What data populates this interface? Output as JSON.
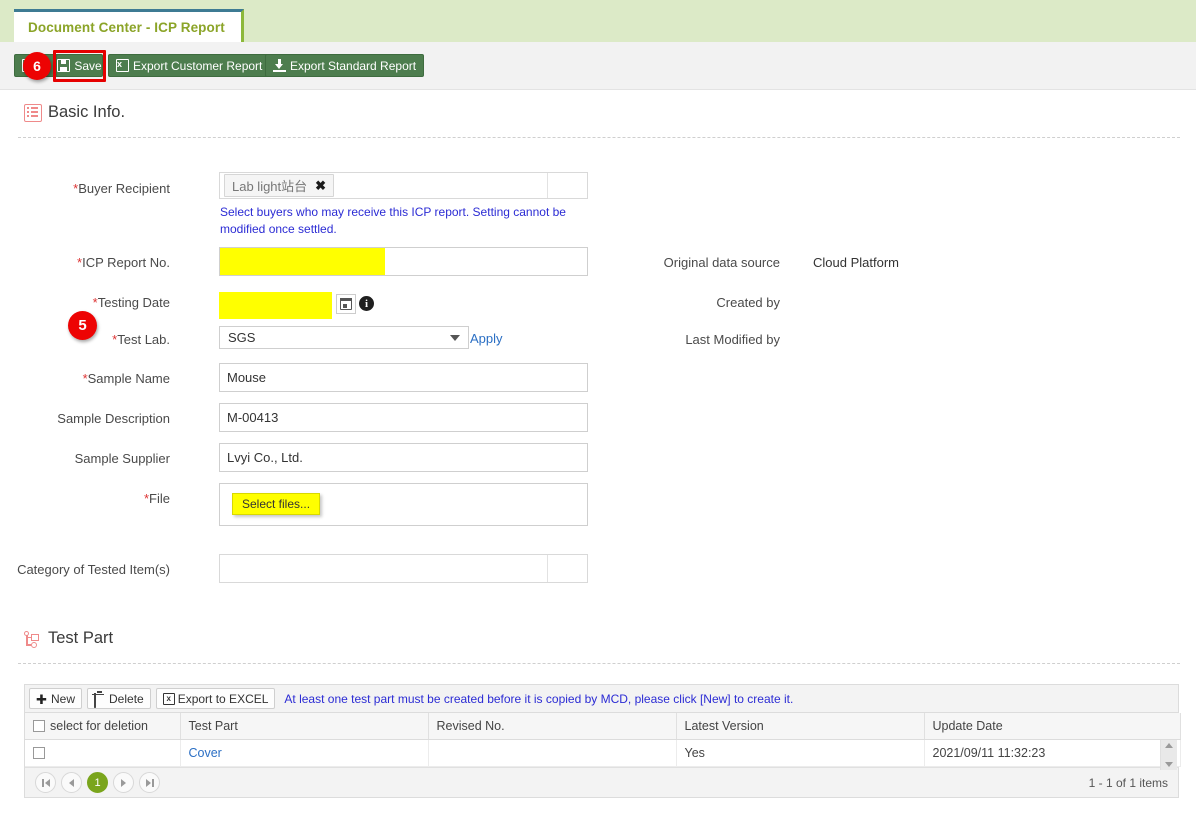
{
  "tab": {
    "label": "Document Center - ICP Report"
  },
  "toolbar": {
    "back_label": "",
    "save_label": "Save",
    "export_customer_label": "Export Customer Report",
    "export_standard_label": "Export Standard Report",
    "icons": {
      "back": "back-icon",
      "save": "floppy-save-icon",
      "excel": "excel-icon",
      "download": "download-icon"
    }
  },
  "badges": {
    "step6": "6",
    "step5": "5"
  },
  "sections": {
    "basic_info": {
      "title": "Basic Info.",
      "icon": "list-icon"
    },
    "test_part": {
      "title": "Test Part",
      "icon": "tree-icon"
    }
  },
  "form": {
    "buyer_recipient": {
      "label": "Buyer Recipient",
      "required": true,
      "chip": "Lab light站台",
      "chip_remove": "✖",
      "hint": "Select buyers who may receive this ICP report. Setting cannot be modified once settled."
    },
    "icp_report_no": {
      "label": "ICP Report No.",
      "required": true,
      "value": "",
      "highlight": "#ffff00"
    },
    "testing_date": {
      "label": "Testing Date",
      "required": true,
      "value": "",
      "highlight": "#ffff00",
      "calendar_icon": "calendar-icon",
      "info_icon": "info-icon"
    },
    "test_lab": {
      "label": "Test Lab.",
      "required": true,
      "value": "SGS",
      "apply_label": "Apply"
    },
    "sample_name": {
      "label": "Sample Name",
      "required": true,
      "value": "Mouse"
    },
    "sample_description": {
      "label": "Sample Description",
      "required": false,
      "value": "M-00413"
    },
    "sample_supplier": {
      "label": "Sample Supplier",
      "required": false,
      "value": "Lvyi Co., Ltd."
    },
    "file": {
      "label": "File",
      "required": true,
      "button_label": "Select files..."
    },
    "category_tested_items": {
      "label": "Category of Tested Item(s)",
      "required": false,
      "value": ""
    }
  },
  "meta": {
    "original_data_source": {
      "label": "Original data source",
      "value": "Cloud Platform"
    },
    "created_by": {
      "label": "Created by",
      "value": ""
    },
    "last_modified_by": {
      "label": "Last Modified by",
      "value": ""
    }
  },
  "grid": {
    "toolbar": {
      "new_label": "New",
      "delete_label": "Delete",
      "export_excel_label": "Export to EXCEL",
      "message": "At least one test part must be created before it is copied by MCD, please click [New] to create it."
    },
    "columns": [
      "select for deletion",
      "Test Part",
      "Revised No.",
      "Latest Version",
      "Update Date"
    ],
    "rows": [
      {
        "selected": false,
        "test_part": "Cover",
        "revised_no": "",
        "latest_version": "Yes",
        "update_date": "2021/09/11 11:32:23"
      }
    ],
    "pager": {
      "first": "first-page-icon",
      "prev": "prev-page-icon",
      "current": "1",
      "next": "next-page-icon",
      "last": "last-page-icon",
      "info": "1 - 1 of 1 items"
    }
  },
  "colors": {
    "tab_text": "#8ba428",
    "tab_top_border": "#3d7b93",
    "toolbar_button": "#4d7d4e",
    "badge": "#ed0303",
    "highlight": "#ffff00",
    "hint_text": "#2b2bd4",
    "link": "#2b6fc4",
    "pager_active": "#7aa51c",
    "section_icon": "#ef8a8a"
  }
}
